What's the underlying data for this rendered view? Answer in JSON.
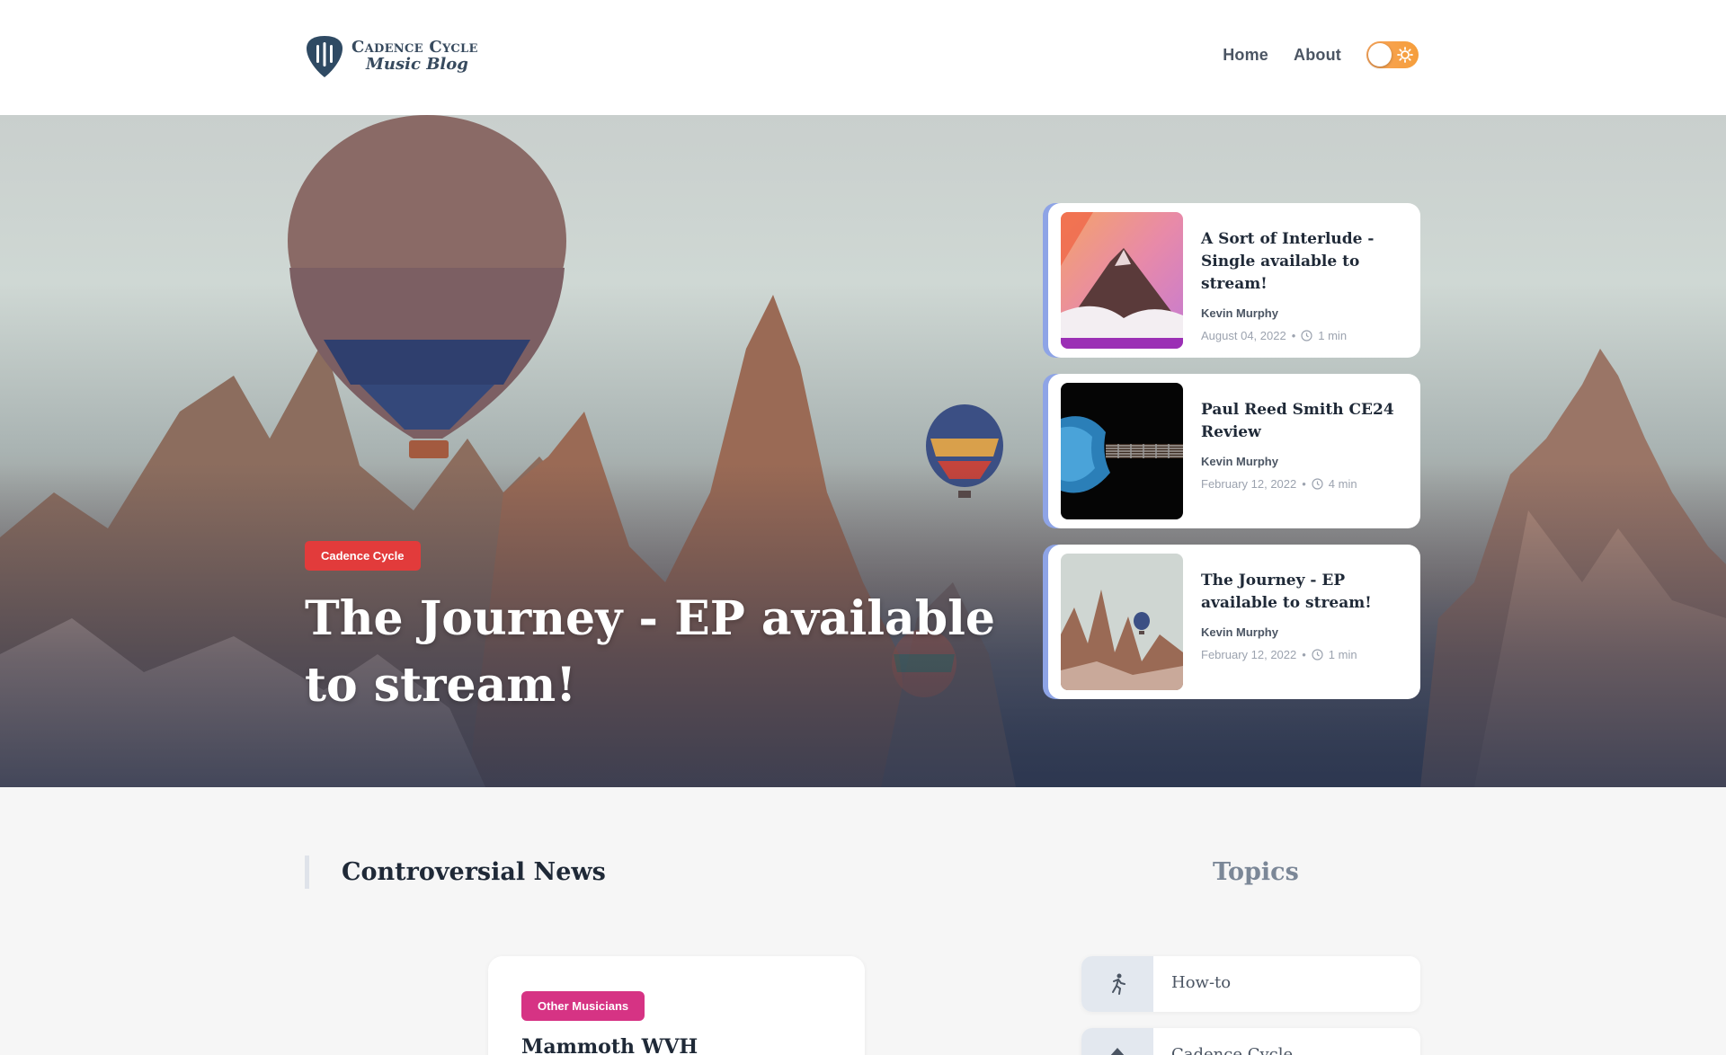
{
  "header": {
    "logo_line1": "Cadence Cycle",
    "logo_line2": "Music Blog",
    "nav": [
      "Home",
      "About"
    ],
    "theme_toggle": "light-mode-toggle"
  },
  "hero": {
    "badge": "Cadence Cycle",
    "title": "The Journey - EP available to stream!",
    "cards": [
      {
        "title": "A Sort of Interlude - Single available to stream!",
        "author": "Kevin Murphy",
        "date": "August 04, 2022",
        "read": "1 min"
      },
      {
        "title": "Paul Reed Smith CE24 Review",
        "author": "Kevin Murphy",
        "date": "February 12, 2022",
        "read": "4 min"
      },
      {
        "title": "The Journey - EP available to stream!",
        "author": "Kevin Murphy",
        "date": "February 12, 2022",
        "read": "1 min"
      }
    ]
  },
  "sections": {
    "news_heading": "Controversial News",
    "topics_heading": "Topics"
  },
  "news": {
    "badge": "Other Musicians",
    "title": "Mammoth WVH"
  },
  "topics": [
    "How-to",
    "Cadence Cycle"
  ],
  "colors": {
    "hero_badge": "#e23b3b",
    "news_badge": "#d63384",
    "card_accent": "#8ea4e6",
    "toggle": "#f59e3b"
  }
}
